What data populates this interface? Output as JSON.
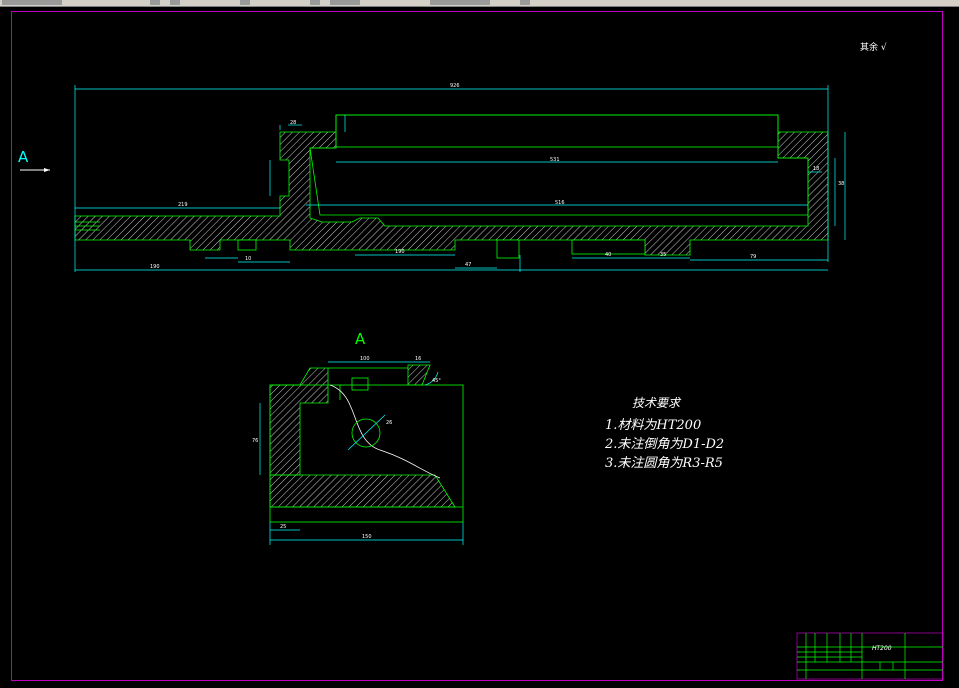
{
  "view_labels": {
    "main": "A",
    "section": "A"
  },
  "roughness_note": "其余 √",
  "tech_requirements": {
    "title": "技术要求",
    "items": [
      "1.材料为HT200",
      "2.未注倒角为D1-D2",
      "3.未注圆角为R3-R5"
    ]
  },
  "title_block": {
    "material": "HT200"
  },
  "dims_main": [
    "926",
    "531",
    "516",
    "219",
    "28",
    "38",
    "18",
    "190",
    "10",
    "47",
    "40",
    "190",
    "35",
    "79"
  ],
  "dims_section": [
    "100",
    "16",
    "45°",
    "26",
    "76",
    "25",
    "150"
  ],
  "colors": {
    "geometry": "#00ff00",
    "dimension": "#00ffff",
    "text": "#ffffff",
    "frame": "#c000c0",
    "hatch": "#ffffff",
    "arrow": "#ff0000"
  }
}
